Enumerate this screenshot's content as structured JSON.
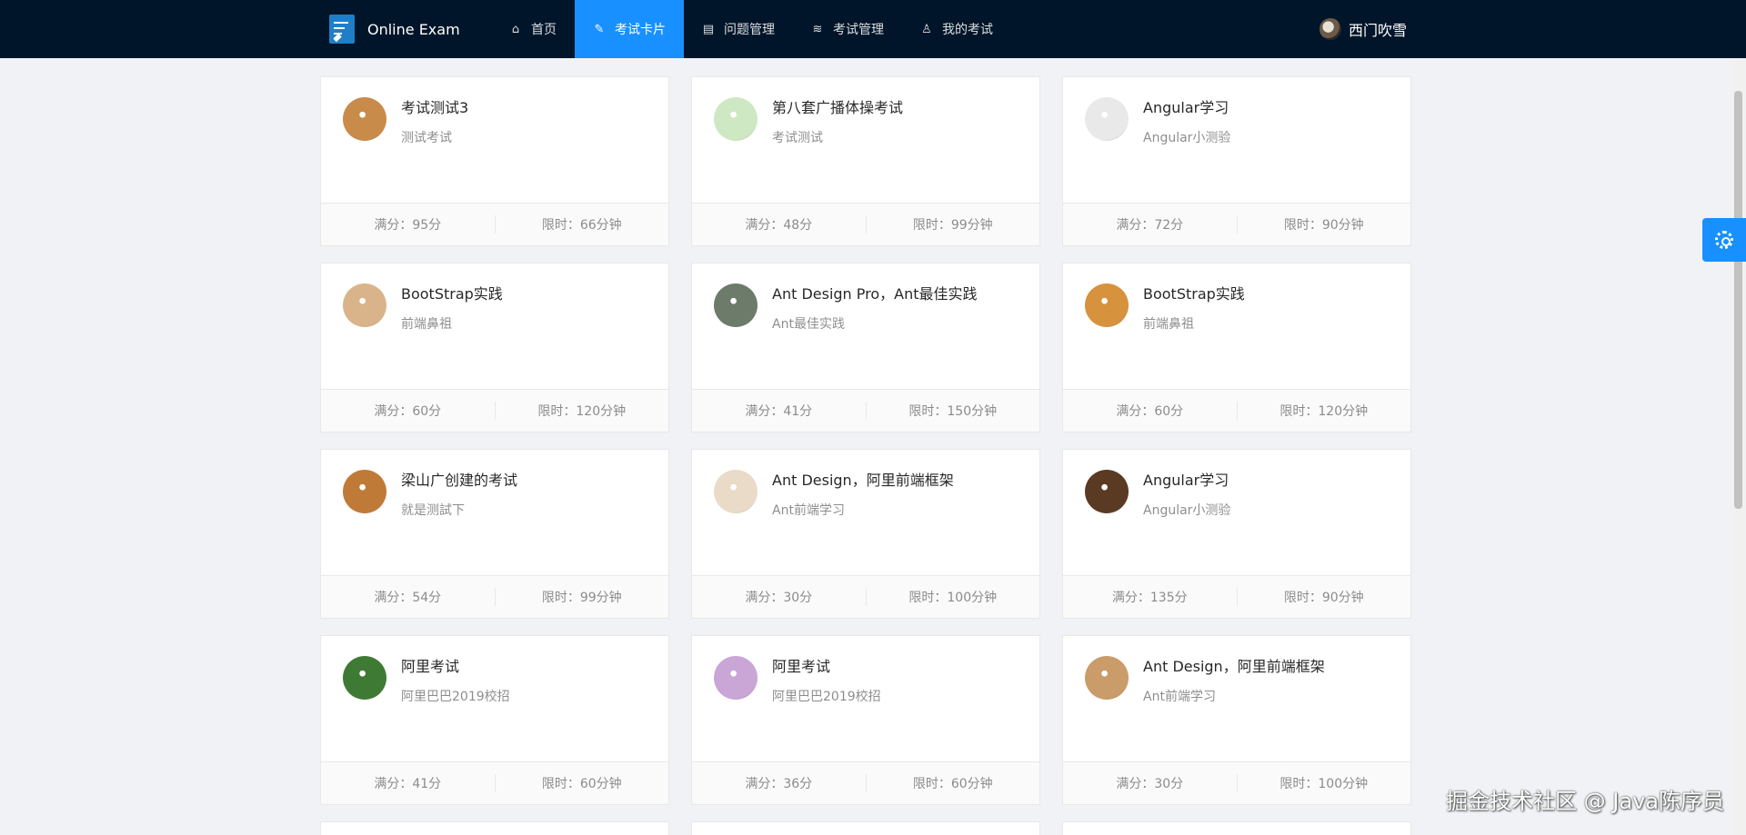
{
  "header": {
    "app_title": "Online Exam",
    "nav": [
      {
        "label": "首页",
        "icon": "home-icon",
        "glyph": "⌂"
      },
      {
        "label": "考试卡片",
        "icon": "card-icon",
        "glyph": "✎"
      },
      {
        "label": "问题管理",
        "icon": "book-icon",
        "glyph": "▤"
      },
      {
        "label": "考试管理",
        "icon": "layers-icon",
        "glyph": "≋"
      },
      {
        "label": "我的考试",
        "icon": "user-icon",
        "glyph": "♙"
      }
    ],
    "user_name": "西门吹雪"
  },
  "cards": [
    {
      "title": "考试测试3",
      "desc": "测试考试",
      "score": "满分：95分",
      "time": "限时：66分钟",
      "avatar_color": "#c98b4a"
    },
    {
      "title": "第八套广播体操考试",
      "desc": "考试测试",
      "score": "满分：48分",
      "time": "限时：99分钟",
      "avatar_color": "#cfe8c4"
    },
    {
      "title": "Angular学习",
      "desc": "Angular小测验",
      "score": "满分：72分",
      "time": "限时：90分钟",
      "avatar_color": "#e9e9e9"
    },
    {
      "title": "BootStrap实践",
      "desc": "前端鼻祖",
      "score": "满分：60分",
      "time": "限时：120分钟",
      "avatar_color": "#d9b48a"
    },
    {
      "title": "Ant Design Pro，Ant最佳实践",
      "desc": "Ant最佳实践",
      "score": "满分：41分",
      "time": "限时：150分钟",
      "avatar_color": "#6c7b6a"
    },
    {
      "title": "BootStrap实践",
      "desc": "前端鼻祖",
      "score": "满分：60分",
      "time": "限时：120分钟",
      "avatar_color": "#d7923e"
    },
    {
      "title": "梁山广创建的考试",
      "desc": "就是测試下",
      "score": "满分：54分",
      "time": "限时：99分钟",
      "avatar_color": "#c07a38"
    },
    {
      "title": "Ant Design，阿里前端框架",
      "desc": "Ant前端学习",
      "score": "满分：30分",
      "time": "限时：100分钟",
      "avatar_color": "#eadbc8"
    },
    {
      "title": "Angular学习",
      "desc": "Angular小测验",
      "score": "满分：135分",
      "time": "限时：90分钟",
      "avatar_color": "#5a3a22"
    },
    {
      "title": "阿里考试",
      "desc": "阿里巴巴2019校招",
      "score": "满分：41分",
      "time": "限时：60分钟",
      "avatar_color": "#3f7a34"
    },
    {
      "title": "阿里考试",
      "desc": "阿里巴巴2019校招",
      "score": "满分：36分",
      "time": "限时：60分钟",
      "avatar_color": "#c9a6d6"
    },
    {
      "title": "Ant Design，阿里前端框架",
      "desc": "Ant前端学习",
      "score": "满分：30分",
      "time": "限时：100分钟",
      "avatar_color": "#c99c6a"
    }
  ],
  "watermark": "掘金技术社区 @ Java陈序员",
  "colors": {
    "header_bg": "#001529",
    "accent": "#1890ff",
    "page_bg": "#f0f2f5"
  }
}
